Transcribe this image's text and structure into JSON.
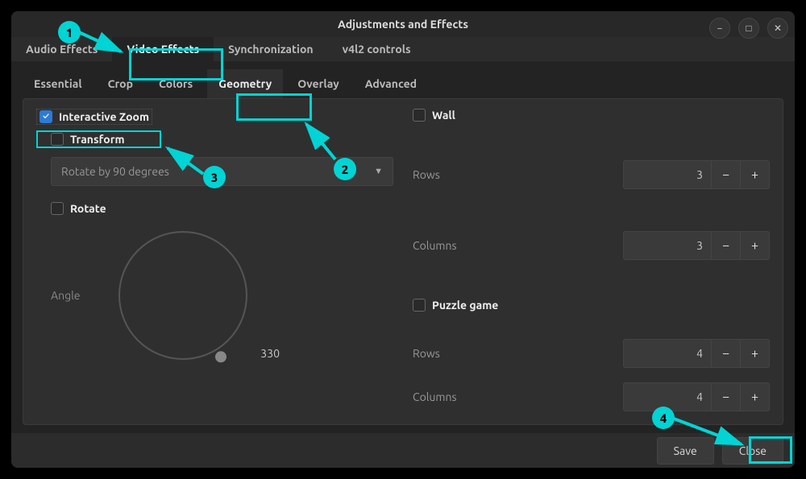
{
  "window": {
    "title": "Adjustments and Effects"
  },
  "main_tabs": [
    "Audio Effects",
    "Video Effects",
    "Synchronization",
    "v4l2 controls"
  ],
  "sub_tabs": [
    "Essential",
    "Crop",
    "Colors",
    "Geometry",
    "Overlay",
    "Advanced"
  ],
  "left": {
    "interactive_zoom": "Interactive Zoom",
    "transform": "Transform",
    "transform_option": "Rotate by 90 degrees",
    "rotate": "Rotate",
    "angle_label": "Angle",
    "angle_value": "330"
  },
  "right": {
    "wall": "Wall",
    "rows_label": "Rows",
    "rows_val": "3",
    "cols_label": "Columns",
    "cols_val": "3",
    "puzzle": "Puzzle game",
    "p_rows_label": "Rows",
    "p_rows_val": "4",
    "p_cols_label": "Columns",
    "p_cols_val": "4"
  },
  "footer": {
    "save": "Save",
    "close": "Close"
  },
  "badges": {
    "b1": "1",
    "b2": "2",
    "b3": "3",
    "b4": "4"
  }
}
